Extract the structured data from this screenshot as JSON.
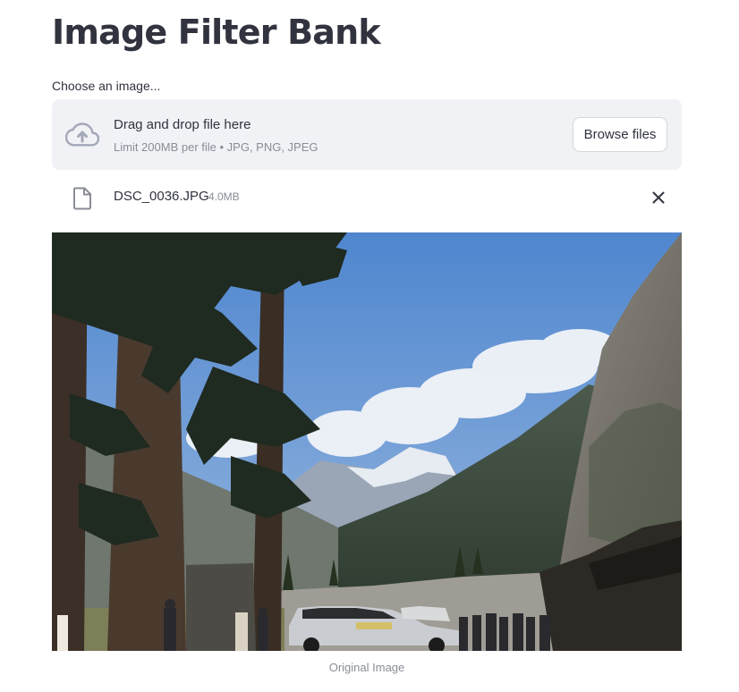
{
  "page": {
    "title": "Image Filter Bank"
  },
  "uploader": {
    "label": "Choose an image...",
    "dropzone_title": "Drag and drop file here",
    "dropzone_subtitle": "Limit 200MB per file • JPG, PNG, JPEG",
    "browse_label": "Browse files",
    "icon": "cloud-upload-icon"
  },
  "uploaded_file": {
    "name": "DSC_0036.JPG",
    "size": "4.0MB",
    "icon": "file-icon",
    "remove_icon": "close-icon"
  },
  "image": {
    "caption": "Original Image"
  },
  "colors": {
    "text": "#31333f",
    "muted": "#8a8d97",
    "dropzone_bg": "#f0f2f6",
    "border": "#d4d6dc"
  }
}
